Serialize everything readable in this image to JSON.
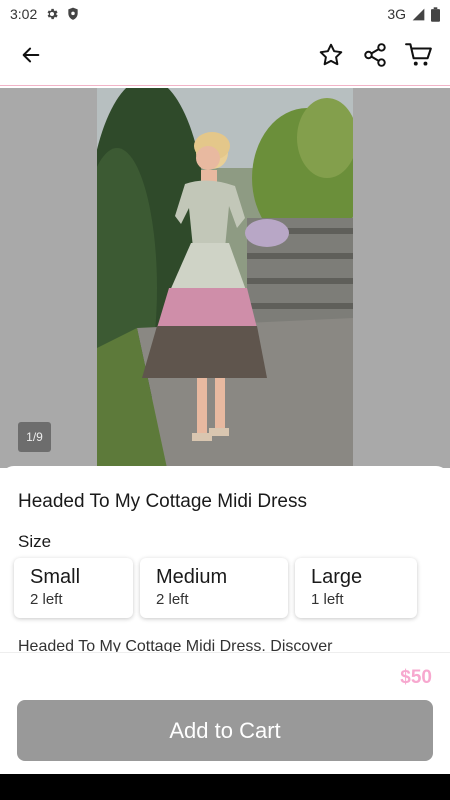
{
  "status_bar": {
    "time": "3:02",
    "network": "3G"
  },
  "gallery": {
    "counter": "1/9"
  },
  "product": {
    "title": "Headed To My Cottage Midi Dress",
    "size_label": "Size",
    "sizes": [
      {
        "name": "Small",
        "stock": "2 left"
      },
      {
        "name": "Medium",
        "stock": "2 left"
      },
      {
        "name": "Large",
        "stock": "1 left"
      }
    ],
    "description": "Headed To My Cottage Midi Dress. Discover"
  },
  "footer": {
    "price": "$50",
    "add_to_cart_label": "Add to Cart"
  },
  "colors": {
    "accent_pink": "#f7a8cf",
    "divider_pink": "#f2b4c8",
    "button_gray": "#999999"
  },
  "icons": [
    "settings-icon",
    "shield-icon",
    "signal-icon",
    "battery-icon",
    "back-arrow-icon",
    "star-icon",
    "share-icon",
    "cart-icon"
  ]
}
